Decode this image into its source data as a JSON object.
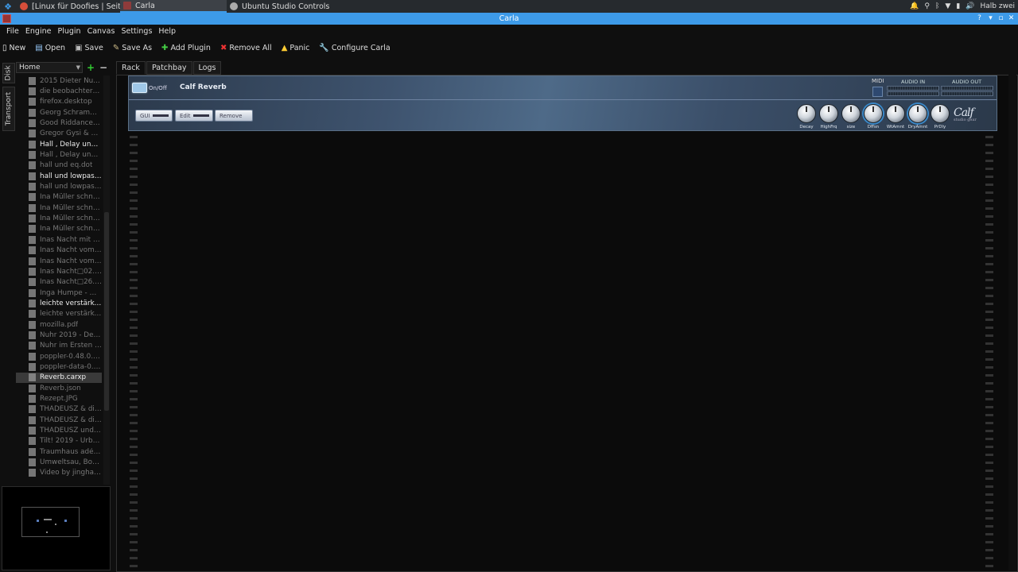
{
  "taskbar": {
    "tasks": [
      {
        "label": "[Linux für Doofies | Seite ...",
        "icon_color": "#d64e3a"
      },
      {
        "label": "Carla",
        "icon_color": "#8f3b3b"
      },
      {
        "label": "Ubuntu Studio Controls",
        "icon_color": "#aaaaaa"
      }
    ],
    "tray_user": "Halb zwei"
  },
  "window": {
    "title": "Carla"
  },
  "menu": [
    "File",
    "Engine",
    "Plugin",
    "Canvas",
    "Settings",
    "Help"
  ],
  "toolbar": {
    "new": "New",
    "open": "Open",
    "save": "Save",
    "save_as": "Save As",
    "add_plugin": "Add Plugin",
    "remove_all": "Remove All",
    "panic": "Panic",
    "configure": "Configure Carla"
  },
  "side_tabs": [
    "Disk",
    "Transport"
  ],
  "file_browser": {
    "location": "Home",
    "files": [
      {
        "name": "2015 Dieter Nu...",
        "bright": false
      },
      {
        "name": "die beobachterT...",
        "bright": false
      },
      {
        "name": "firefox.desktop",
        "bright": false
      },
      {
        "name": "Georg Schramm ...",
        "bright": false
      },
      {
        "name": "Good Riddance (...",
        "bright": false
      },
      {
        "name": "Gregor Gysi & M...",
        "bright": false
      },
      {
        "name": "Hall , Delay und ...",
        "bright": true
      },
      {
        "name": "Hall , Delay und ...",
        "bright": false
      },
      {
        "name": "hall und eq.dot",
        "bright": false
      },
      {
        "name": "hall und lowpass....",
        "bright": true
      },
      {
        "name": "hall und lowpass....",
        "bright": false
      },
      {
        "name": "Ina Müller schna...",
        "bright": false
      },
      {
        "name": "Ina Müller schna...",
        "bright": false
      },
      {
        "name": "Ina Müller schna...",
        "bright": false
      },
      {
        "name": "Ina Müller schna...",
        "bright": false
      },
      {
        "name": "Inas Nacht mit L...",
        "bright": false
      },
      {
        "name": "Inas Nacht vom ...",
        "bright": false
      },
      {
        "name": "Inas Nacht vom ...",
        "bright": false
      },
      {
        "name": "Inas Nacht□02.1...",
        "bright": false
      },
      {
        "name": "Inas Nacht□26.1...",
        "bright": false
      },
      {
        "name": "Inga Humpe - M...",
        "bright": false
      },
      {
        "name": "leichte verstärku...",
        "bright": true
      },
      {
        "name": "leichte verstärku...",
        "bright": false
      },
      {
        "name": "mozilla.pdf",
        "bright": false
      },
      {
        "name": "Nuhr 2019 - Der...",
        "bright": false
      },
      {
        "name": "Nuhr im Ersten v...",
        "bright": false
      },
      {
        "name": "poppler-0.48.0.t...",
        "bright": false
      },
      {
        "name": "poppler-data-0.4...",
        "bright": false
      },
      {
        "name": "Reverb.carxp",
        "bright": true,
        "selected": true
      },
      {
        "name": "Reverb.json",
        "bright": false
      },
      {
        "name": "Rezept.JPG",
        "bright": false
      },
      {
        "name": "THADEUSZ & die...",
        "bright": false
      },
      {
        "name": "THADEUSZ & die...",
        "bright": false
      },
      {
        "name": "THADEUSZ und ...",
        "bright": false
      },
      {
        "name": "Tilt! 2019 - Urba...",
        "bright": false
      },
      {
        "name": "Traumhaus adé ...",
        "bright": false
      },
      {
        "name": "Umweltsau, Bon...",
        "bright": false
      },
      {
        "name": "Video by jinghao...",
        "bright": false
      }
    ]
  },
  "tabs": [
    "Rack",
    "Patchbay",
    "Logs"
  ],
  "active_tab": "Rack",
  "plugin": {
    "name": "Calf Reverb",
    "onoff_label": "On/Off",
    "gui_label": "GUI",
    "edit_label": "Edit",
    "remove_label": "Remove",
    "midi_label": "MIDI",
    "audio_in_label": "AUDIO IN",
    "audio_out_label": "AUDIO OUT",
    "knobs": [
      {
        "label": "Decay",
        "highlight": false
      },
      {
        "label": "HighFrq",
        "highlight": false
      },
      {
        "label": "size",
        "highlight": false
      },
      {
        "label": "Dffsn",
        "highlight": true
      },
      {
        "label": "WtAmnt",
        "highlight": false
      },
      {
        "label": "DryAmnt",
        "highlight": true
      },
      {
        "label": "PrDly",
        "highlight": false
      }
    ],
    "brand": "Calf",
    "brand_sub": "studio gear"
  },
  "colors": {
    "accent": "#3d9ae8",
    "background": "#0f0f0f",
    "plugin_bg": "#3e536e"
  }
}
